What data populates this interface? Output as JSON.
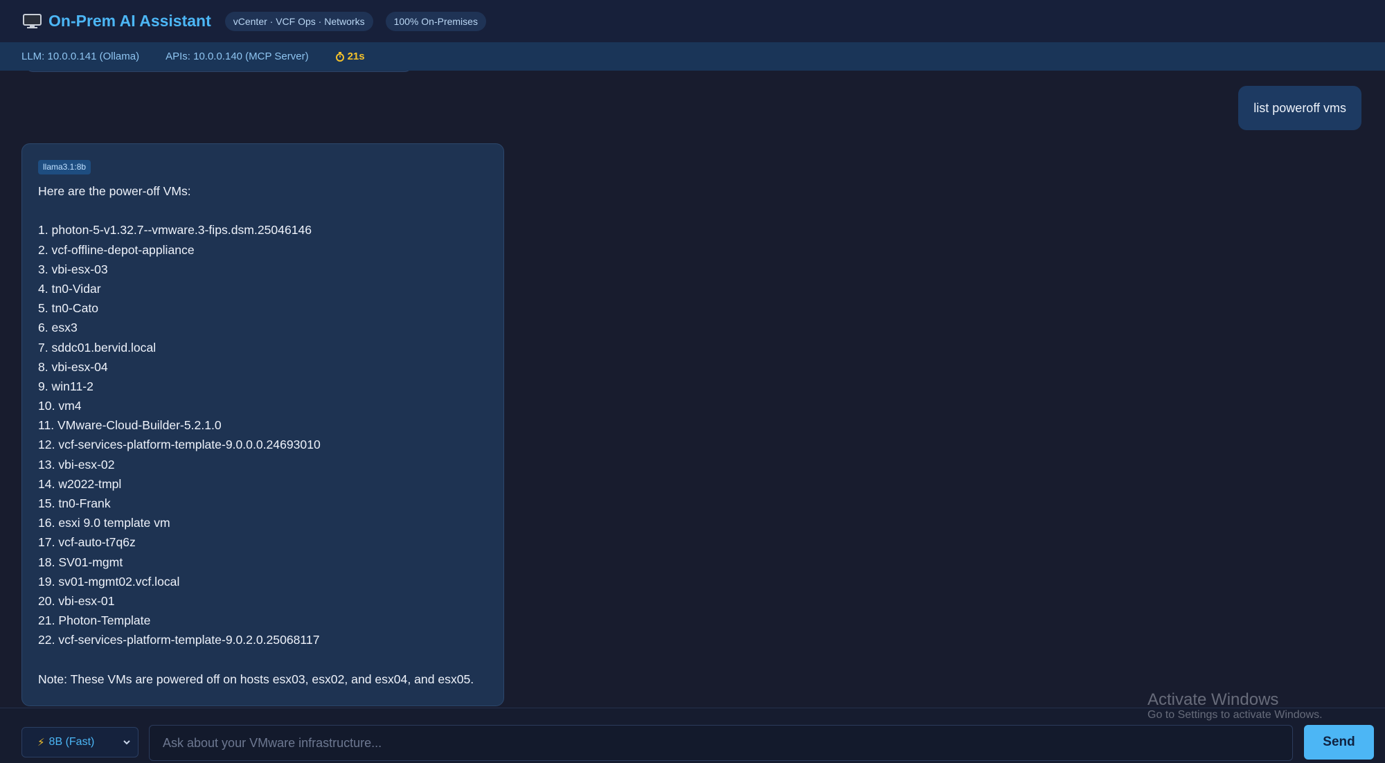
{
  "header": {
    "title": "On-Prem AI Assistant",
    "pills": [
      "vCenter · VCF Ops · Networks",
      "100% On-Premises"
    ]
  },
  "status": {
    "llm": "LLM: 10.0.0.141 (Ollama)",
    "apis": "APIs: 10.0.0.140 (MCP Server)",
    "timer": "21s"
  },
  "chat": {
    "user_message": "list poweroff vms",
    "model_tag": "llama3.1:8b",
    "intro": "Here are the power-off VMs:",
    "vms": [
      "1. photon-5-v1.32.7--vmware.3-fips.dsm.25046146",
      "2. vcf-offline-depot-appliance",
      "3. vbi-esx-03",
      "4. tn0-Vidar",
      "5. tn0-Cato",
      "6. esx3",
      "7. sddc01.bervid.local",
      "8. vbi-esx-04",
      "9. win11-2",
      "10. vm4",
      "11. VMware-Cloud-Builder-5.2.1.0",
      "12. vcf-services-platform-template-9.0.0.0.24693010",
      "13. vbi-esx-02",
      "14. w2022-tmpl",
      "15. tn0-Frank",
      "16. esxi 9.0 template vm",
      "17. vcf-auto-t7q6z",
      "18. SV01-mgmt",
      "19. sv01-mgmt02.vcf.local",
      "20. vbi-esx-01",
      "21. Photon-Template",
      "22. vcf-services-platform-template-9.0.2.0.25068117"
    ],
    "note": "Note: These VMs are powered off on hosts esx03, esx02, and esx04, and esx05."
  },
  "input_bar": {
    "model_select": "8B (Fast)",
    "placeholder": "Ask about your VMware infrastructure...",
    "send_label": "Send"
  },
  "watermark": {
    "title": "Activate Windows",
    "subtitle": "Go to Settings to activate Windows."
  },
  "colors": {
    "accent": "#4cb6f5",
    "timer": "#f4c22b",
    "background": "#181c2e"
  }
}
